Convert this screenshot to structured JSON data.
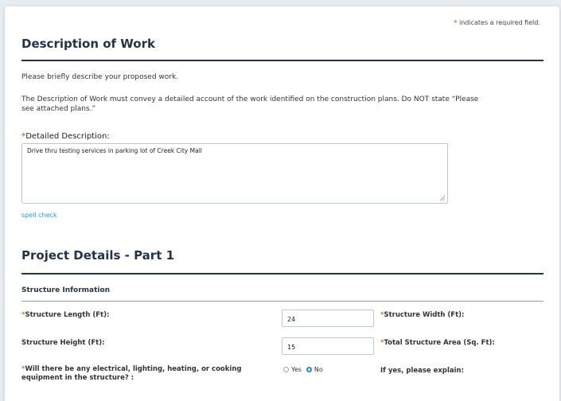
{
  "required_note": {
    "star": "*",
    "text": " indicates a required field."
  },
  "description_section": {
    "title": "Description of Work",
    "intro": "Please briefly describe your proposed work.",
    "instructions_line1": "The Description of Work must convey a detailed account of the work identified on the construction plans. Do NOT state “Please",
    "instructions_line2": "see attached plans.”",
    "detailed_label": "Detailed Description:",
    "detailed_value": "Drive thru testing services in parking lot of Creek City Mall",
    "spell_check": "spell check"
  },
  "project_section": {
    "title": "Project Details - Part 1",
    "subheading": "Structure Information",
    "fields": {
      "length_label": "Structure Length (Ft):",
      "length_value": "24",
      "width_label": "Structure Width (Ft):",
      "height_label": "Structure Height (Ft):",
      "height_value": "15",
      "total_area_label": "Total Structure Area (Sq. Ft):",
      "equipment_label_line1": "Will there be any electrical, lighting, heating, or cooking",
      "equipment_label_line2": "equipment in the structure? :",
      "yes_label": "Yes",
      "no_label": "No",
      "selected": "No",
      "explain_label": "If yes, please explain:"
    }
  },
  "colors": {
    "accent": "#243447",
    "required_star": "#d97a24",
    "link": "#1a9fd5",
    "radio_selected": "#1f8fd0"
  }
}
